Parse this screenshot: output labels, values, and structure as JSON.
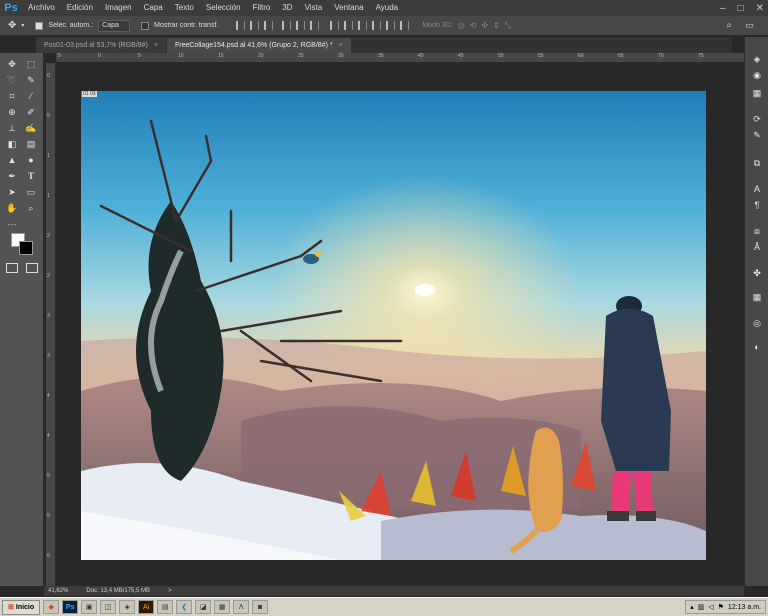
{
  "app": {
    "logo": "Ps",
    "accent": "#31a8ff"
  },
  "menu": [
    "Archivo",
    "Edición",
    "Imagen",
    "Capa",
    "Texto",
    "Selección",
    "Filtro",
    "3D",
    "Vista",
    "Ventana",
    "Ayuda"
  ],
  "window_controls": [
    "–",
    "□",
    "✕"
  ],
  "options": {
    "auto_select_label": "Selec. autom.:",
    "auto_select_value": "Capa",
    "show_transform_label": "Mostrar contr. transf.",
    "mode3d_label": "Modo 3D:"
  },
  "tabs": [
    {
      "label": "Pos01-03.psd al 53,7% (RGB/8#)",
      "close": "×"
    },
    {
      "label": "FreeCollage154.psd al 41,6% (Grupo 2, RGB/8#) *",
      "close": "×"
    }
  ],
  "artboard_label": "01 03",
  "ruler_top": [
    "5",
    "0",
    "5",
    "10",
    "15",
    "20",
    "25",
    "30",
    "35",
    "40",
    "45",
    "50",
    "55",
    "60",
    "65",
    "70",
    "75"
  ],
  "ruler_left": [
    "0",
    "5",
    "1",
    "1",
    "2",
    "2",
    "3",
    "3",
    "4",
    "4",
    "5",
    "5",
    "6"
  ],
  "status": {
    "zoom": "41,62%",
    "doc": "Doc: 13,4 MB/175,5 MB",
    "arrow": ">"
  },
  "taskbar": {
    "start_label": "Inicio",
    "apps": [
      "",
      "",
      "",
      "",
      "",
      "",
      "",
      "",
      "",
      "",
      "",
      ""
    ],
    "clock": "12:13 a.m."
  }
}
